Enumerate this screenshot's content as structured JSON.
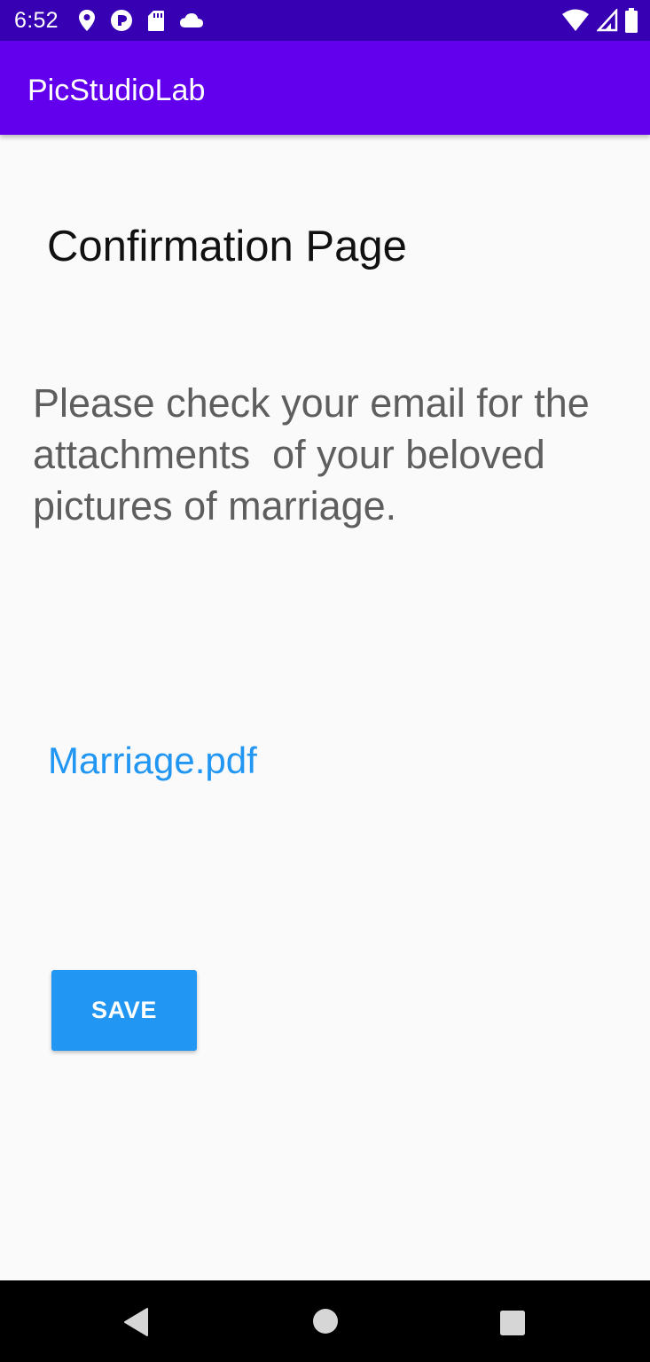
{
  "status_bar": {
    "time": "6:52",
    "left_icons": [
      "location-icon",
      "data-saver-icon",
      "sd-card-icon",
      "cloud-icon"
    ],
    "right_icons": [
      "wifi-icon",
      "cell-signal-icon",
      "battery-icon"
    ]
  },
  "app_bar": {
    "title": "PicStudioLab",
    "color": "#6200ee"
  },
  "main": {
    "page_title": "Confirmation Page",
    "message": "Please check your email for the attachments  of your beloved pictures of marriage.",
    "file_link": "Marriage.pdf",
    "save_label": "SAVE",
    "accent_color": "#2196f3"
  },
  "nav_bar": {
    "buttons": [
      "back-icon",
      "home-icon",
      "recents-icon"
    ]
  }
}
